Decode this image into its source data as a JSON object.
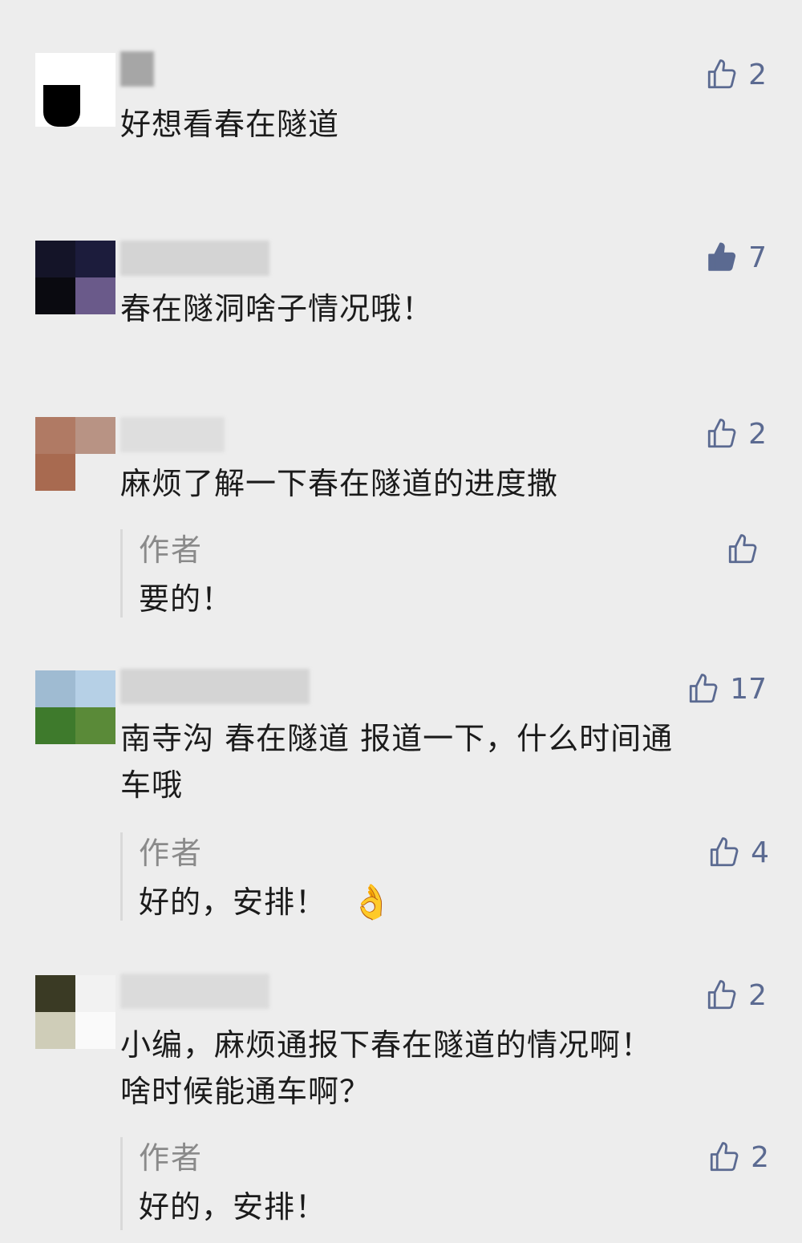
{
  "comments": [
    {
      "text": "好想看春在隧道",
      "likes": "2",
      "liked": false
    },
    {
      "text": "春在隧洞啥子情况哦！",
      "likes": "7",
      "liked": true
    },
    {
      "text": "麻烦了解一下春在隧道的进度撒",
      "likes": "2",
      "liked": false,
      "reply": {
        "author": "作者",
        "text": "要的！",
        "likes": ""
      }
    },
    {
      "text_line1": "南寺沟 春在隧道 报道一下，什么时间通",
      "text_line2": "车哦",
      "likes": "17",
      "liked": false,
      "reply": {
        "author": "作者",
        "text": "好的，安排！",
        "emoji": "ok-hand-icon",
        "likes": "4"
      }
    },
    {
      "text_line1": "小编，麻烦通报下春在隧道的情况啊！",
      "text_line2": "啥时候能通车啊？",
      "likes": "2",
      "liked": false,
      "reply": {
        "author": "作者",
        "text": "好的，安排！",
        "likes": "2"
      }
    }
  ],
  "colors": {
    "background": "#ededed",
    "like_color": "#5b6a91",
    "author_color": "#8a8a8a"
  }
}
